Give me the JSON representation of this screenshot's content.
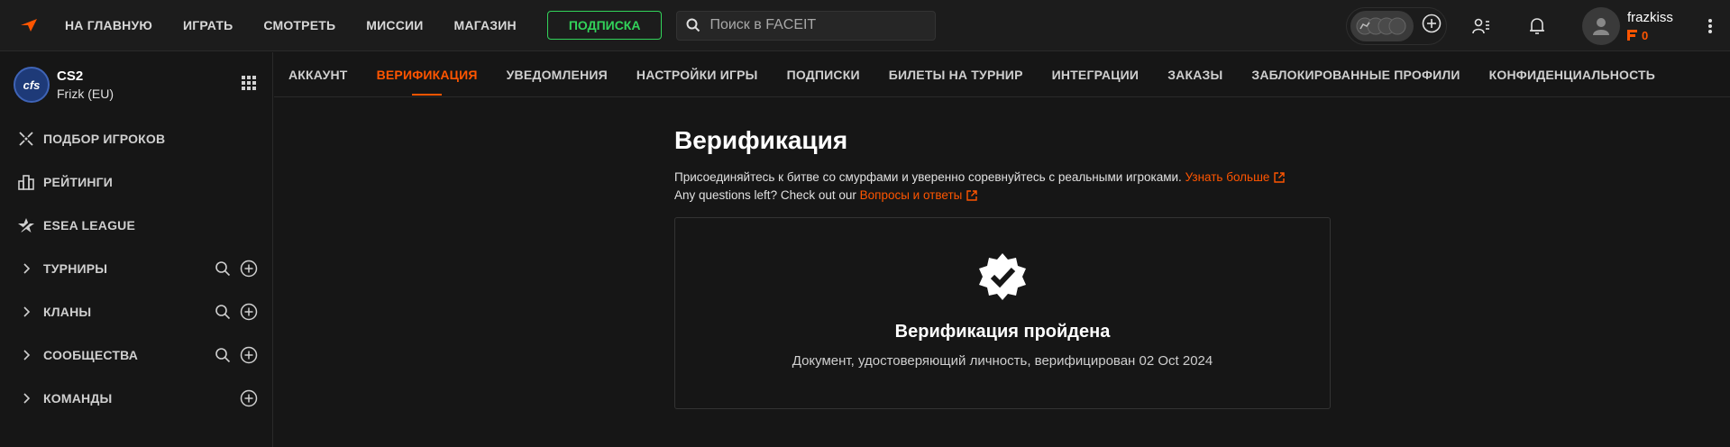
{
  "topbar": {
    "nav": [
      "НА ГЛАВНУЮ",
      "ИГРАТЬ",
      "СМОТРЕТЬ",
      "МИССИИ",
      "МАГАЗИН"
    ],
    "subscribe_label": "ПОДПИСКА",
    "search_placeholder": "Поиск в FACEIT",
    "username": "frazkiss",
    "points": "0"
  },
  "sidebar": {
    "game": {
      "name": "CS2",
      "region": "Frizk (EU)",
      "logo_text": "cfs"
    },
    "items": [
      {
        "label": "ПОДБОР ИГРОКОВ",
        "icon": "crosshair-icon"
      },
      {
        "label": "РЕЙТИНГИ",
        "icon": "ranking-icon"
      },
      {
        "label": "ESEA LEAGUE",
        "icon": "esea-star-icon"
      },
      {
        "label": "ТУРНИРЫ",
        "icon": "chevron-right-icon"
      },
      {
        "label": "КЛАНЫ",
        "icon": "chevron-right-icon"
      },
      {
        "label": "СООБЩЕСТВА",
        "icon": "chevron-right-icon"
      },
      {
        "label": "КОМАНДЫ",
        "icon": "chevron-right-icon"
      }
    ]
  },
  "tabs": [
    "АККАУНТ",
    "ВЕРИФИКАЦИЯ",
    "УВЕДОМЛЕНИЯ",
    "НАСТРОЙКИ ИГРЫ",
    "ПОДПИСКИ",
    "БИЛЕТЫ НА ТУРНИР",
    "ИНТЕГРАЦИИ",
    "ЗАКАЗЫ",
    "ЗАБЛОКИРОВАННЫЕ ПРОФИЛИ",
    "КОНФИДЕНЦИАЛЬНОСТЬ"
  ],
  "main": {
    "title": "Верификация",
    "desc1": "Присоединяйтесь к битве со смурфами и уверенно соревнуйтесь с реальными игроками.",
    "learn_more": "Узнать больше",
    "desc2": "Any questions left? Check out our",
    "faq": "Вопросы и ответы",
    "card_title": "Верификация пройдена",
    "card_sub": "Документ, удостоверяющий личность, верифицирован 02 Oct 2024"
  },
  "colors": {
    "accent": "#ff5500",
    "subscribe": "#32d35a",
    "bg": "#161616"
  }
}
